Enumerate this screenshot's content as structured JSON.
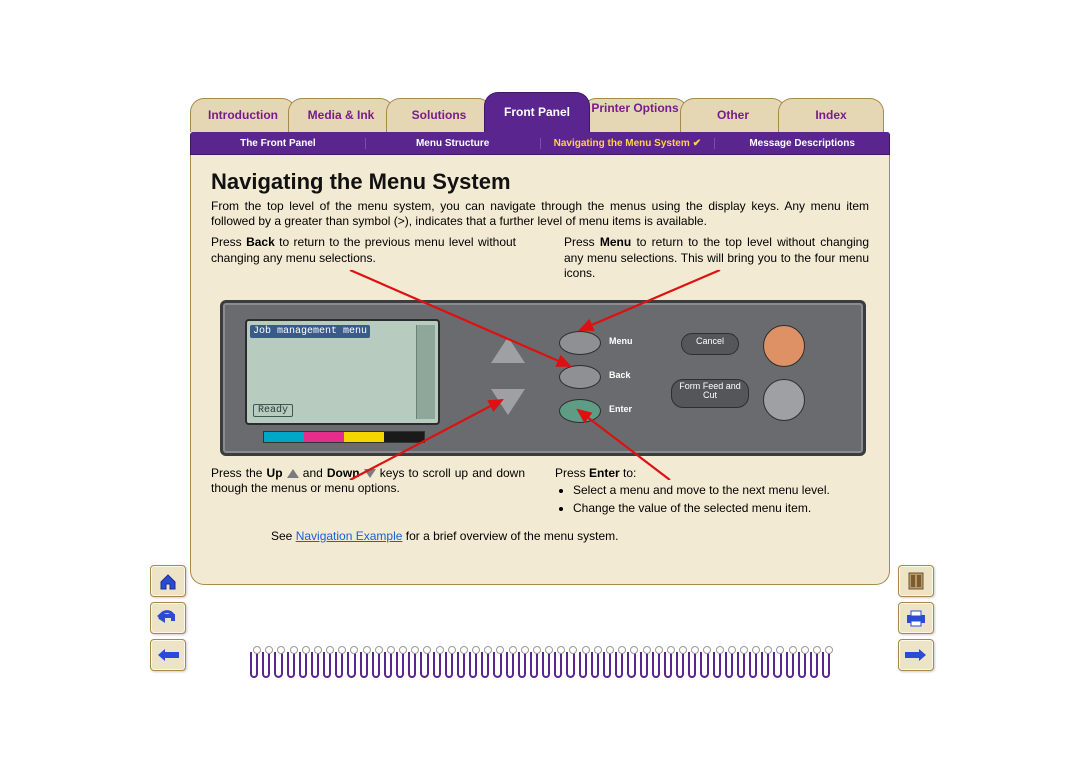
{
  "tabs": [
    "Introduction",
    "Media & Ink",
    "Solutions",
    "Front Panel",
    "Printer Options",
    "Other",
    "Index"
  ],
  "activeTab": 3,
  "subtabs": [
    "The Front Panel",
    "Menu Structure",
    "Navigating the Menu System",
    "Message Descriptions"
  ],
  "activeSubtab": 2,
  "title": "Navigating the Menu System",
  "intro": "From the top level of the menu system, you can navigate through the menus using the display keys. Any menu item followed by a greater than symbol (>), indicates that a further level of menu items is available.",
  "back_text_pre": "Press ",
  "back_text_bold": "Back",
  "back_text_post": " to return to the previous menu level without changing any menu selections.",
  "menu_text_pre": "Press ",
  "menu_text_bold": "Menu",
  "menu_text_post": " to return to the top level without changing any menu selections. This will bring you to the four menu icons.",
  "lcd_title": "Job management menu",
  "lcd_status": "Ready",
  "btn_menu": "Menu",
  "btn_back": "Back",
  "btn_enter": "Enter",
  "btn_cancel": "Cancel",
  "btn_ff": "Form Feed and Cut",
  "updown_pre": "Press the ",
  "updown_up": "Up",
  "updown_mid": " and ",
  "updown_down": "Down",
  "updown_post": " keys to scroll up and down though the menus or menu options.",
  "enter_pre": "Press ",
  "enter_bold": "Enter",
  "enter_post": " to:",
  "enter_b1": "Select a menu and move to the next menu level.",
  "enter_b2": "Change the value of the selected menu item.",
  "see_pre": "See ",
  "see_link": "Navigation Example",
  "see_post": " for a brief overview of the menu system.",
  "ink_colors": [
    "#00a7c7",
    "#e52e8b",
    "#f4d600",
    "#1a1a1a"
  ]
}
